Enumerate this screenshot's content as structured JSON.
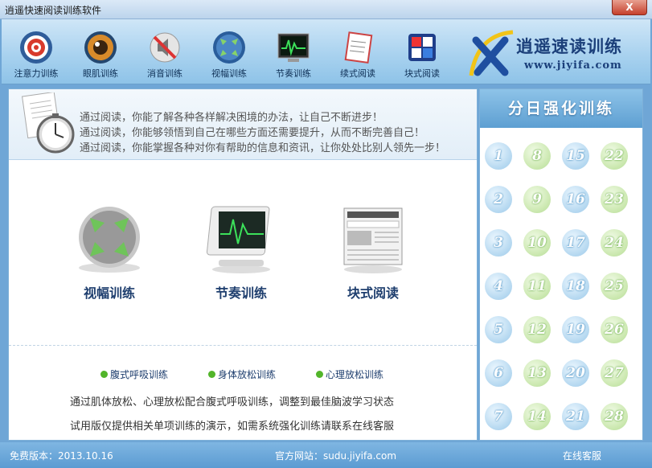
{
  "window": {
    "title": "逍遥快速阅读训练软件",
    "close_label": "X"
  },
  "toolbar": {
    "items": [
      {
        "label": "注意力训练",
        "icon": "target-icon"
      },
      {
        "label": "眼肌训练",
        "icon": "eye-icon"
      },
      {
        "label": "消音训练",
        "icon": "mute-icon"
      },
      {
        "label": "视幅训练",
        "icon": "expand-icon"
      },
      {
        "label": "节奏训练",
        "icon": "monitor-icon"
      },
      {
        "label": "续式阅读",
        "icon": "notebook-icon"
      },
      {
        "label": "块式阅读",
        "icon": "blocks-icon"
      }
    ]
  },
  "logo": {
    "brand": "逍遥速读训练",
    "url": "www.jiyifa.com"
  },
  "banner": {
    "lines": [
      "通过阅读，你能了解各种各样解决困境的办法，让自己不断进步！",
      "通过阅读，你能够领悟到自己在哪些方面还需要提升，从而不断完善自己！",
      "通过阅读，你能掌握各种对你有帮助的信息和资讯，让你处处比别人领先一步！"
    ]
  },
  "features": [
    {
      "label": "视幅训练"
    },
    {
      "label": "节奏训练"
    },
    {
      "label": "块式阅读"
    }
  ],
  "extras": [
    "腹式呼吸训练",
    "身体放松训练",
    "心理放松训练"
  ],
  "notes": [
    "通过肌体放松、心理放松配合腹式呼吸训练，调整到最佳脑波学习状态",
    "试用版仅提供相关单项训练的演示，如需系统强化训练请联系在线客服"
  ],
  "side": {
    "title": "分日强化训练",
    "days": [
      [
        "1",
        "8",
        "15",
        "22"
      ],
      [
        "2",
        "9",
        "16",
        "23"
      ],
      [
        "3",
        "10",
        "17",
        "24"
      ],
      [
        "4",
        "11",
        "18",
        "25"
      ],
      [
        "5",
        "12",
        "19",
        "26"
      ],
      [
        "6",
        "13",
        "20",
        "27"
      ],
      [
        "7",
        "14",
        "21",
        "28"
      ]
    ]
  },
  "status": {
    "version": "免费版本：2013.10.16",
    "site": "官方网站：sudu.jiyifa.com",
    "support": "在线客服"
  },
  "colors": {
    "accent_blue": "#5d9fd2",
    "green_dot": "#52b52a"
  }
}
